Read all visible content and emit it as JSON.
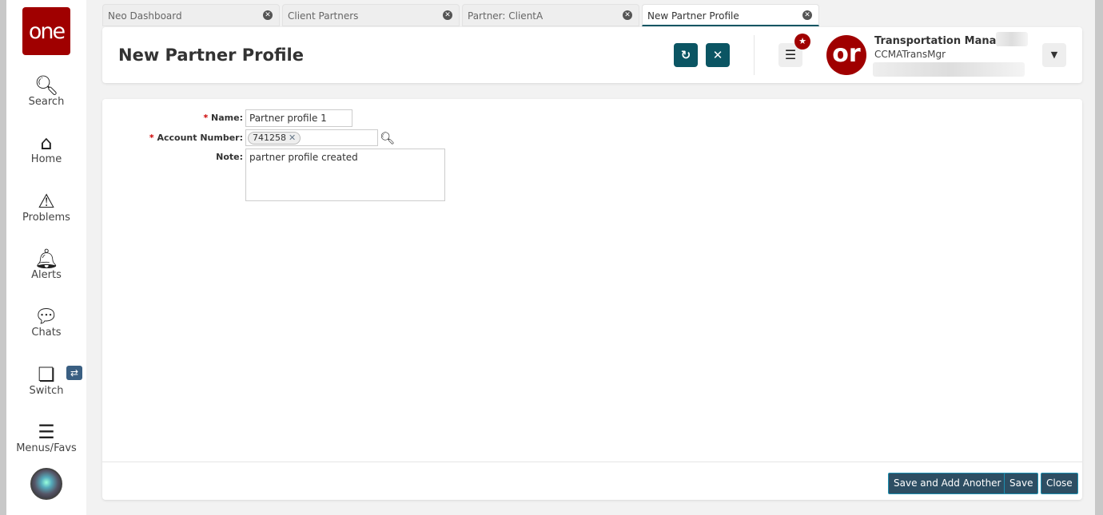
{
  "sidebar": {
    "logo": "one",
    "items": [
      {
        "label": "Search",
        "icon": "search-icon"
      },
      {
        "label": "Home",
        "icon": "home-icon"
      },
      {
        "label": "Problems",
        "icon": "warning-icon"
      },
      {
        "label": "Alerts",
        "icon": "bell-icon"
      },
      {
        "label": "Chats",
        "icon": "chat-icon"
      },
      {
        "label": "Switch",
        "icon": "switch-icon"
      },
      {
        "label": "Menus/Favs",
        "icon": "menu-icon"
      }
    ]
  },
  "tabs": [
    {
      "label": "Neo Dashboard"
    },
    {
      "label": "Client Partners"
    },
    {
      "label": "Partner: ClientA"
    },
    {
      "label": "New Partner Profile",
      "active": true
    }
  ],
  "header": {
    "title": "New Partner Profile",
    "user_name": "Transportation Manager",
    "user_id": "CCMATransMgr"
  },
  "form": {
    "name_label": "Name:",
    "name_value": "Partner profile 1",
    "account_label": "Account Number:",
    "account_chip": "741258",
    "note_label": "Note:",
    "note_value": "partner profile created",
    "required_mark": "*"
  },
  "footer": {
    "save_add": "Save and Add Another",
    "save": "Save",
    "close": "Close"
  },
  "colors": {
    "brand": "#a00000",
    "accent": "#0b5563",
    "button": "#2d4e63"
  }
}
